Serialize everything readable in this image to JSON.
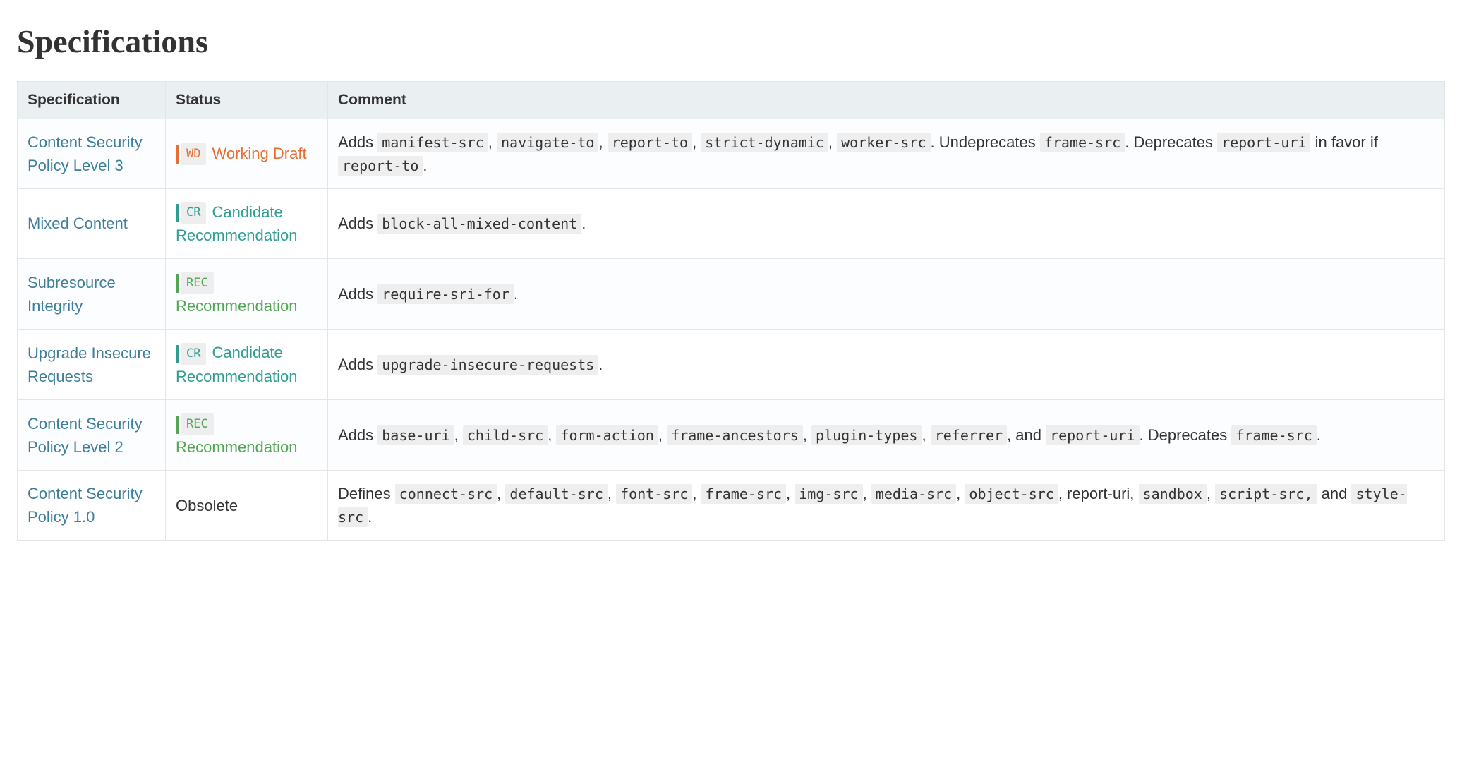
{
  "heading": "Specifications",
  "columns": [
    "Specification",
    "Status",
    "Comment"
  ],
  "status_colors": {
    "WD": {
      "bar": "#e66e33",
      "text": "#e66e33",
      "label_bg": "#eee",
      "label_color": "#e66e33"
    },
    "CR": {
      "bar": "#2f9e91",
      "text": "#2f9e91",
      "label_bg": "#eee",
      "label_color": "#2f9e91"
    },
    "REC": {
      "bar": "#52a552",
      "text": "#52a552",
      "label_bg": "#eee",
      "label_color": "#52a552"
    },
    "NONE": {
      "bar": "",
      "text": "#333",
      "label_bg": "",
      "label_color": ""
    }
  },
  "rows": [
    {
      "spec": "Content Security Policy Level 3",
      "status": {
        "code": "WD",
        "label": "WD",
        "text": "Working Draft"
      },
      "comment_parts": [
        {
          "t": "text",
          "v": "Adds "
        },
        {
          "t": "code",
          "v": "manifest-src"
        },
        {
          "t": "text",
          "v": ", "
        },
        {
          "t": "code",
          "v": "navigate-to"
        },
        {
          "t": "text",
          "v": ", "
        },
        {
          "t": "code",
          "v": "report-to"
        },
        {
          "t": "text",
          "v": ", "
        },
        {
          "t": "code",
          "v": "strict-dynamic"
        },
        {
          "t": "text",
          "v": ", "
        },
        {
          "t": "code",
          "v": "worker-src"
        },
        {
          "t": "text",
          "v": ". Undeprecates "
        },
        {
          "t": "code",
          "v": "frame-src"
        },
        {
          "t": "text",
          "v": ". Deprecates "
        },
        {
          "t": "code",
          "v": "report-uri"
        },
        {
          "t": "text",
          "v": " in favor if "
        },
        {
          "t": "code",
          "v": "report-to"
        },
        {
          "t": "text",
          "v": "."
        }
      ]
    },
    {
      "spec": "Mixed Content",
      "status": {
        "code": "CR",
        "label": "CR",
        "text": "Candidate Recommendation"
      },
      "comment_parts": [
        {
          "t": "text",
          "v": "Adds "
        },
        {
          "t": "code",
          "v": "block-all-mixed-content"
        },
        {
          "t": "text",
          "v": "."
        }
      ]
    },
    {
      "spec": "Subresource Integrity",
      "status": {
        "code": "REC",
        "label": "REC",
        "text": "Recommendation"
      },
      "comment_parts": [
        {
          "t": "text",
          "v": "Adds "
        },
        {
          "t": "code",
          "v": "require-sri-for"
        },
        {
          "t": "text",
          "v": "."
        }
      ]
    },
    {
      "spec": "Upgrade Insecure Requests",
      "status": {
        "code": "CR",
        "label": "CR",
        "text": "Candidate Recommendation"
      },
      "comment_parts": [
        {
          "t": "text",
          "v": "Adds "
        },
        {
          "t": "code",
          "v": "upgrade-insecure-requests"
        },
        {
          "t": "text",
          "v": "."
        }
      ]
    },
    {
      "spec": "Content Security Policy Level 2",
      "status": {
        "code": "REC",
        "label": "REC",
        "text": "Recommendation"
      },
      "comment_parts": [
        {
          "t": "text",
          "v": "Adds "
        },
        {
          "t": "code",
          "v": "base-uri"
        },
        {
          "t": "text",
          "v": ", "
        },
        {
          "t": "code",
          "v": "child-src"
        },
        {
          "t": "text",
          "v": ", "
        },
        {
          "t": "code",
          "v": "form-action"
        },
        {
          "t": "text",
          "v": ", "
        },
        {
          "t": "code",
          "v": "frame-ancestors"
        },
        {
          "t": "text",
          "v": ", "
        },
        {
          "t": "code",
          "v": "plugin-types"
        },
        {
          "t": "text",
          "v": ", "
        },
        {
          "t": "code",
          "v": "referrer"
        },
        {
          "t": "text",
          "v": ", and "
        },
        {
          "t": "code",
          "v": "report-uri"
        },
        {
          "t": "text",
          "v": ". Deprecates "
        },
        {
          "t": "code",
          "v": "frame-src"
        },
        {
          "t": "text",
          "v": "."
        }
      ]
    },
    {
      "spec": "Content Security Policy 1.0",
      "status": {
        "code": "NONE",
        "label": "",
        "text": "Obsolete"
      },
      "comment_parts": [
        {
          "t": "text",
          "v": "Defines "
        },
        {
          "t": "code",
          "v": "connect-src"
        },
        {
          "t": "text",
          "v": ", "
        },
        {
          "t": "code",
          "v": "default-src"
        },
        {
          "t": "text",
          "v": ", "
        },
        {
          "t": "code",
          "v": "font-src"
        },
        {
          "t": "text",
          "v": ", "
        },
        {
          "t": "code",
          "v": "frame-src"
        },
        {
          "t": "text",
          "v": ", "
        },
        {
          "t": "code",
          "v": "img-src"
        },
        {
          "t": "text",
          "v": ", "
        },
        {
          "t": "code",
          "v": "media-src"
        },
        {
          "t": "text",
          "v": ", "
        },
        {
          "t": "code",
          "v": "object-src"
        },
        {
          "t": "text",
          "v": ", report-uri, "
        },
        {
          "t": "code",
          "v": "sandbox"
        },
        {
          "t": "text",
          "v": ", "
        },
        {
          "t": "code",
          "v": "script-src,"
        },
        {
          "t": "text",
          "v": " and "
        },
        {
          "t": "code",
          "v": "style-src"
        },
        {
          "t": "text",
          "v": "."
        }
      ]
    }
  ]
}
